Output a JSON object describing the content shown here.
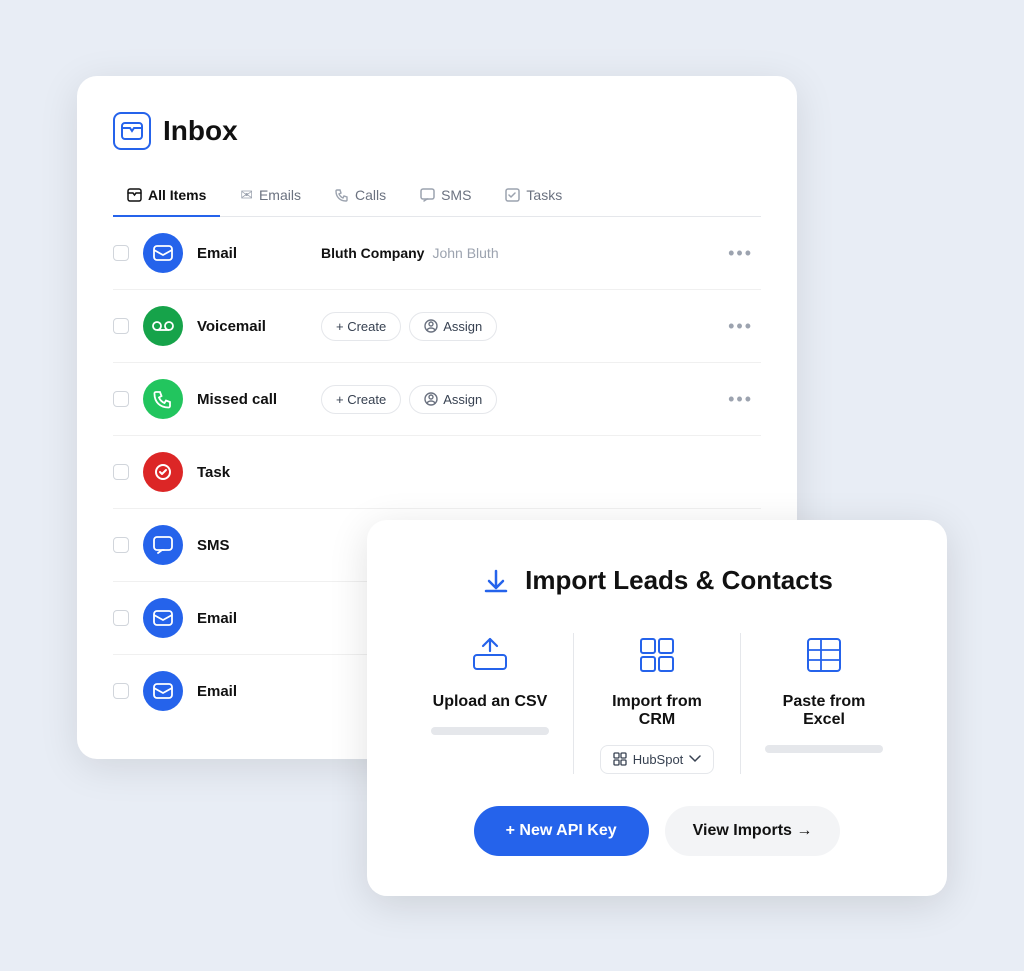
{
  "page": {
    "bg": "#e8edf5"
  },
  "inbox": {
    "title": "Inbox",
    "tabs": [
      {
        "label": "All Items",
        "active": true,
        "icon": "inbox"
      },
      {
        "label": "Emails",
        "active": false,
        "icon": "email"
      },
      {
        "label": "Calls",
        "active": false,
        "icon": "phone"
      },
      {
        "label": "SMS",
        "active": false,
        "icon": "sms"
      },
      {
        "label": "Tasks",
        "active": false,
        "icon": "task"
      }
    ],
    "items": [
      {
        "type": "Email",
        "color": "blue",
        "company": "Bluth Company",
        "contact": "John Bluth",
        "showActions": false
      },
      {
        "type": "Voicemail",
        "color": "green",
        "showActions": true,
        "createLabel": "+ Create",
        "assignLabel": "Assign"
      },
      {
        "type": "Missed call",
        "color": "green-light",
        "showActions": true,
        "createLabel": "+ Create",
        "assignLabel": "Assign"
      },
      {
        "type": "Task",
        "color": "red",
        "showActions": false
      },
      {
        "type": "SMS",
        "color": "blue-bright",
        "showActions": false
      },
      {
        "type": "Email",
        "color": "blue",
        "showActions": false
      },
      {
        "type": "Email",
        "color": "blue",
        "showActions": false
      }
    ]
  },
  "import": {
    "title": "Import Leads & Contacts",
    "options": [
      {
        "label": "Upload an CSV",
        "icon": "upload"
      },
      {
        "label": "Import from CRM",
        "icon": "grid",
        "hasSelect": true,
        "selectLabel": "HubSpot"
      },
      {
        "label": "Paste from Excel",
        "icon": "table"
      }
    ],
    "buttons": {
      "primary": "+ New API Key",
      "secondary": "View Imports →"
    }
  }
}
